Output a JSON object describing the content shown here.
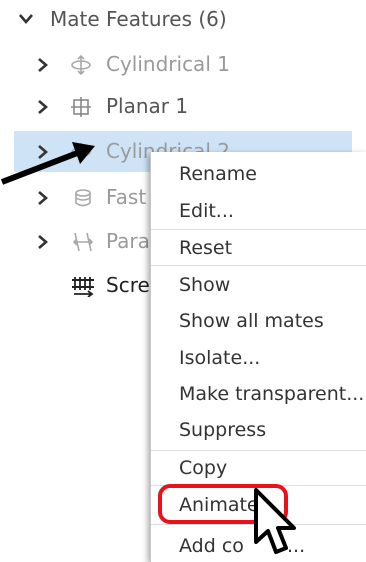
{
  "tree": {
    "group_label": "Mate Features (6)",
    "items": [
      {
        "label": "Cylindrical 1",
        "icon": "cylindrical-mate-icon"
      },
      {
        "label": "Planar 1",
        "icon": "planar-mate-icon"
      },
      {
        "label": "Cylindrical 2",
        "icon": "cylindrical-mate-icon"
      },
      {
        "label": "Fast",
        "icon": "fastened-mate-icon"
      },
      {
        "label": "Para",
        "icon": "parallel-mate-icon"
      },
      {
        "label": "Scre",
        "icon": "screw-relation-icon"
      }
    ]
  },
  "context_menu": {
    "items": [
      "Rename",
      "Edit...",
      "Reset",
      "Show",
      "Show all mates",
      "Isolate...",
      "Make transparent...",
      "Suppress",
      "Copy",
      "Animate",
      "Add co",
      "..."
    ]
  },
  "colors": {
    "selection": "#cfe3f7",
    "highlight": "#e8131a"
  }
}
